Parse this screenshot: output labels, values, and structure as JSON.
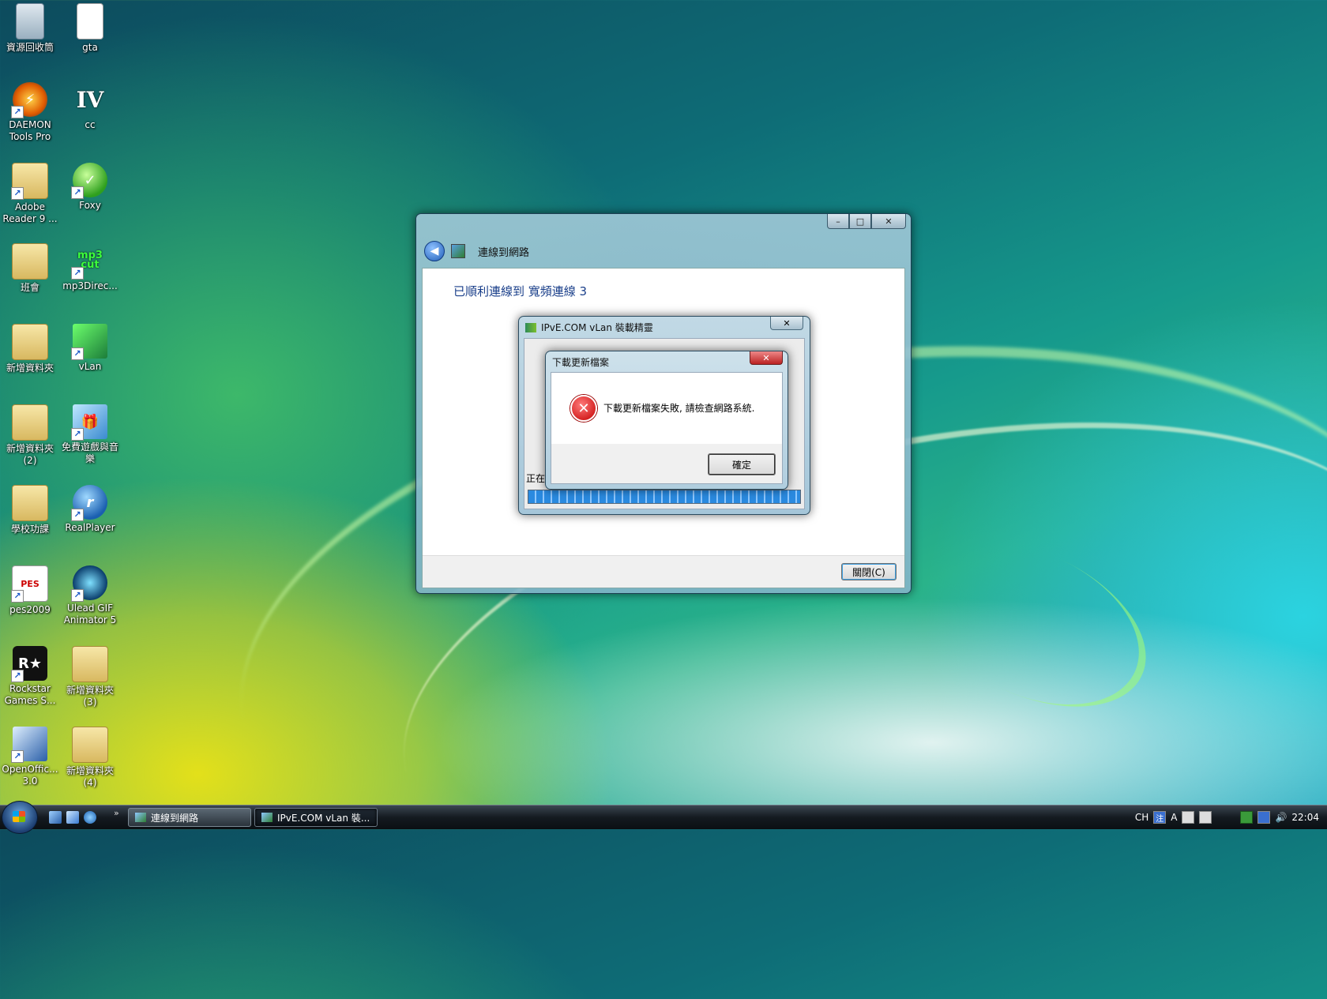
{
  "desktop": {
    "icons": [
      {
        "label": "資源回收筒",
        "icon": "recycle-bin-icon"
      },
      {
        "label": "gta",
        "icon": "document-icon"
      },
      {
        "label": "DAEMON Tools Pro",
        "icon": "daemon-tools-icon"
      },
      {
        "label": "cc",
        "icon": "gta-iv-icon"
      },
      {
        "label": "Adobe Reader 9 ...",
        "icon": "folder-icon"
      },
      {
        "label": "Foxy",
        "icon": "foxy-icon"
      },
      {
        "label": "班會",
        "icon": "folder-icon"
      },
      {
        "label": "mp3Direc...",
        "icon": "mp3directcut-icon"
      },
      {
        "label": "新增資料夾",
        "icon": "folder-icon"
      },
      {
        "label": "vLan",
        "icon": "vlan-icon"
      },
      {
        "label": "新增資料夾 (2)",
        "icon": "folder-icon"
      },
      {
        "label": "免費遊戲與音樂",
        "icon": "gift-icon"
      },
      {
        "label": "學校功課",
        "icon": "folder-icon"
      },
      {
        "label": "RealPlayer",
        "icon": "realplayer-icon"
      },
      {
        "label": "pes2009",
        "icon": "pes-icon"
      },
      {
        "label": "Ulead GIF Animator 5",
        "icon": "ulead-icon"
      },
      {
        "label": "Rockstar Games S...",
        "icon": "rockstar-icon"
      },
      {
        "label": "新增資料夾 (3)",
        "icon": "folder-icon"
      },
      {
        "label": "OpenOffic... 3.0",
        "icon": "openoffice-icon"
      },
      {
        "label": "新增資料夾 (4)",
        "icon": "folder-icon"
      }
    ]
  },
  "main_window": {
    "nav_title": "連線到網路",
    "success_text": "已順利連線到 寬頻連線 3",
    "close_button": "關閉(C)",
    "caption": {
      "minimize": "–",
      "maximize": "□",
      "close": "✕"
    }
  },
  "setup_window": {
    "title": "IPvE.COM vLan 裝載精靈",
    "close": "✕",
    "status_prefix": "正在",
    "progress": 1.0
  },
  "error_dialog": {
    "title": "下載更新檔案",
    "close": "✕",
    "message": "下載更新檔案失敗, 請檢查網路系統.",
    "ok_button": "確定",
    "icon_glyph": "✕"
  },
  "taskbar": {
    "buttons": [
      {
        "label": "連線到網路"
      },
      {
        "label": "IPvE.COM vLan 裝..."
      }
    ],
    "quick_launch_more": "»",
    "tray": {
      "lang": "CH",
      "ime_a": "A",
      "clock": "22:04"
    }
  },
  "colors": {
    "accent": "#1a3f8a",
    "error": "#c40000"
  }
}
